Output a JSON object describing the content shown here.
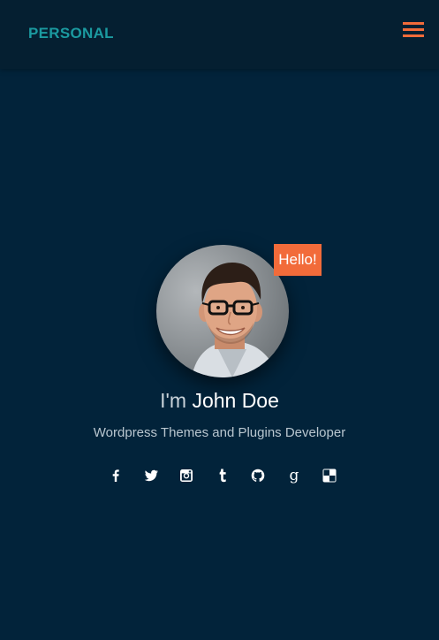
{
  "navbar": {
    "brand": "PERSONAL",
    "menu_icon": "hamburger-menu-icon"
  },
  "hero": {
    "badge": "Hello!",
    "greeting_prefix": "I'm",
    "name": "John Doe",
    "tagline": "Wordpress Themes and Plugins Developer",
    "avatar_description": "avatar-photo"
  },
  "social": [
    {
      "icon": "facebook-icon"
    },
    {
      "icon": "twitter-icon"
    },
    {
      "icon": "instagram-icon"
    },
    {
      "icon": "tumblr-icon"
    },
    {
      "icon": "github-icon"
    },
    {
      "icon": "google-icon"
    },
    {
      "icon": "delicious-icon"
    }
  ],
  "colors": {
    "background": "#02233a",
    "navbar": "#051f31",
    "brand": "#1b9aa0",
    "accent": "#f26b3a"
  }
}
